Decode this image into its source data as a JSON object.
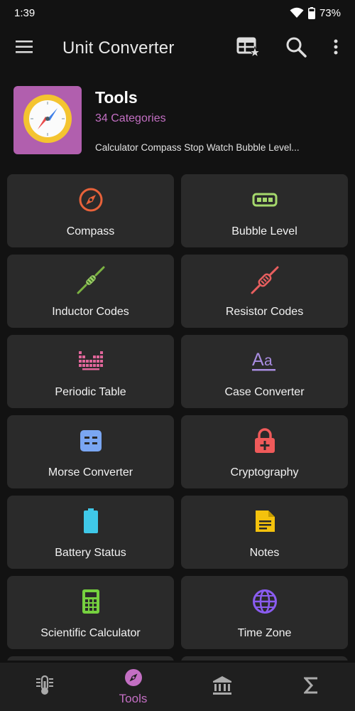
{
  "status": {
    "time": "1:39",
    "battery": "73%"
  },
  "app_bar": {
    "title": "Unit Converter"
  },
  "header": {
    "title": "Tools",
    "count": "34 Categories",
    "description": "Calculator Compass Stop Watch Bubble Level..."
  },
  "tools": [
    {
      "name": "compass",
      "label": "Compass",
      "icon": "compass-icon",
      "color": "#e8623a"
    },
    {
      "name": "bubble-level",
      "label": "Bubble Level",
      "icon": "bubble-level-icon",
      "color": "#a5d86c"
    },
    {
      "name": "inductor-codes",
      "label": "Inductor Codes",
      "icon": "inductor-icon",
      "color": "#7cb342"
    },
    {
      "name": "resistor-codes",
      "label": "Resistor Codes",
      "icon": "resistor-icon",
      "color": "#e85f5f"
    },
    {
      "name": "periodic-table",
      "label": "Periodic Table",
      "icon": "periodic-table-icon",
      "color": "#e0669a"
    },
    {
      "name": "case-converter",
      "label": "Case Converter",
      "icon": "text-case-icon",
      "color": "#a88ce0"
    },
    {
      "name": "morse-converter",
      "label": "Morse Converter",
      "icon": "morse-icon",
      "color": "#7aa6f2"
    },
    {
      "name": "cryptography",
      "label": "Cryptography",
      "icon": "lock-icon",
      "color": "#ef5a5a"
    },
    {
      "name": "battery-status",
      "label": "Battery Status",
      "icon": "battery-icon",
      "color": "#3fc8e8"
    },
    {
      "name": "notes",
      "label": "Notes",
      "icon": "notes-icon",
      "color": "#f4c20d"
    },
    {
      "name": "scientific-calculator",
      "label": "Scientific Calculator",
      "icon": "calculator-icon",
      "color": "#76d13f"
    },
    {
      "name": "time-zone",
      "label": "Time Zone",
      "icon": "globe-icon",
      "color": "#8a5cf0"
    }
  ],
  "bottom_nav": [
    {
      "name": "units",
      "icon": "thermometer-icon",
      "label": ""
    },
    {
      "name": "tools",
      "icon": "compass-icon",
      "label": "Tools",
      "active": true
    },
    {
      "name": "finance",
      "icon": "bank-icon",
      "label": ""
    },
    {
      "name": "math",
      "icon": "sigma-icon",
      "label": ""
    }
  ],
  "colors": {
    "accent": "#c36fc3",
    "background": "#121212",
    "card": "#2a2a2a"
  }
}
